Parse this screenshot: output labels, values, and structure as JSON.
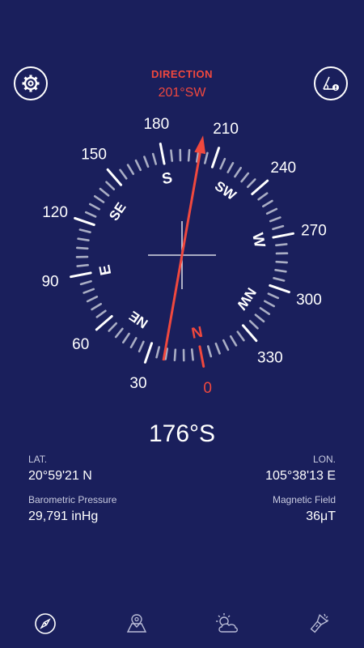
{
  "header": {
    "direction_title": "DIRECTION",
    "direction_value": "201°SW"
  },
  "compass": {
    "outer_degrees": [
      "180",
      "210",
      "240",
      "270",
      "300",
      "330",
      "0",
      "30",
      "60",
      "90",
      "120",
      "150"
    ],
    "cardinals": [
      "S",
      "SW",
      "W",
      "NW",
      "N",
      "NE",
      "E",
      "SE"
    ],
    "needle_bearing": 201,
    "accent_color": "#f0483e"
  },
  "heading": {
    "value": "176°S"
  },
  "info": {
    "lat_label": "LAT.",
    "lat_value": "20°59'21 N",
    "lon_label": "LON.",
    "lon_value": "105°38'13 E",
    "pressure_label": "Barometric Pressure",
    "pressure_value": "29,791 inHg",
    "magnetic_label": "Magnetic Field",
    "magnetic_value": "36μT"
  },
  "icons": {
    "settings": "gear-icon",
    "inclinometer": "inclinometer-icon",
    "nav": [
      "compass-icon",
      "map-icon",
      "weather-icon",
      "flashlight-icon"
    ]
  }
}
